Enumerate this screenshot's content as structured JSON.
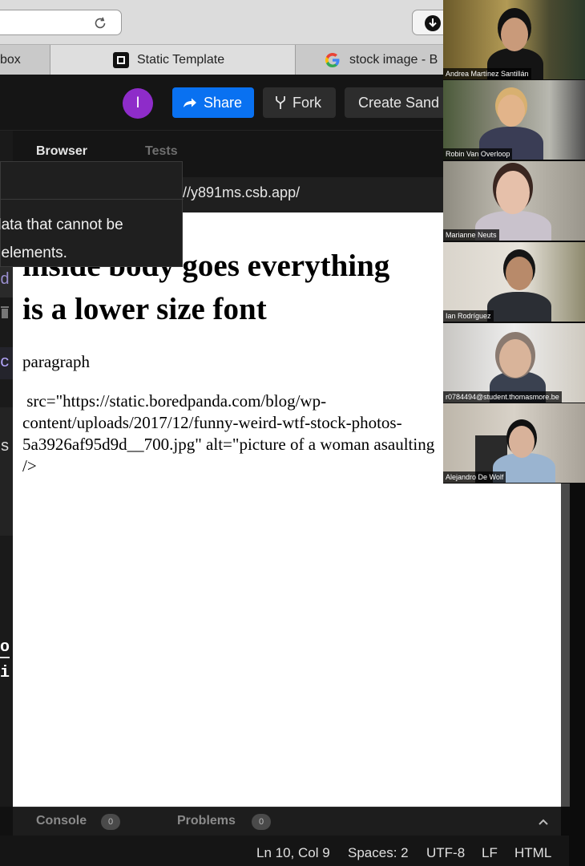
{
  "browser": {
    "tabs": [
      {
        "label": "box"
      },
      {
        "label": "Static Template"
      },
      {
        "label": "stock image - B"
      }
    ]
  },
  "header": {
    "avatar_initial": "I",
    "share_label": "Share",
    "fork_label": "Fork",
    "create_label": "Create Sand"
  },
  "panel": {
    "tabs": [
      "Browser",
      "Tests"
    ],
    "address": "//y891ms.csb.app/"
  },
  "tooltip": {
    "lines": "data that cannot be\nt elements."
  },
  "preview": {
    "heading": "inside body goes everything\nis a lower size font",
    "paragraph": "paragraph",
    "img_code": " src=\"https://static.boredpanda.com/blog/wp-\ncontent/uploads/2017/12/funny-weird-wtf-stock-photos-\n5a3926af95d9d__700.jpg\" alt=\"picture of a woman asaulting\n/>"
  },
  "sidebar": {
    "chars": [
      "d",
      "c",
      "s",
      "o",
      "i"
    ]
  },
  "console": {
    "console_label": "Console",
    "console_count": "0",
    "problems_label": "Problems",
    "problems_count": "0"
  },
  "status": {
    "position": "Ln 10, Col 9",
    "spaces": "Spaces: 2",
    "encoding": "UTF-8",
    "eol": "LF",
    "language": "HTML"
  },
  "participants": [
    {
      "name": "Andrea Martínez Santillán"
    },
    {
      "name": "Robin Van Overloop"
    },
    {
      "name": "Marianne Neuts"
    },
    {
      "name": "Ian Rodríguez"
    },
    {
      "name": "r0784494@student.thomasmore.be"
    },
    {
      "name": "Alejandro De Wolf"
    }
  ],
  "colors": {
    "share_blue": "#0971f1",
    "avatar_purple": "#8e2cc9"
  }
}
